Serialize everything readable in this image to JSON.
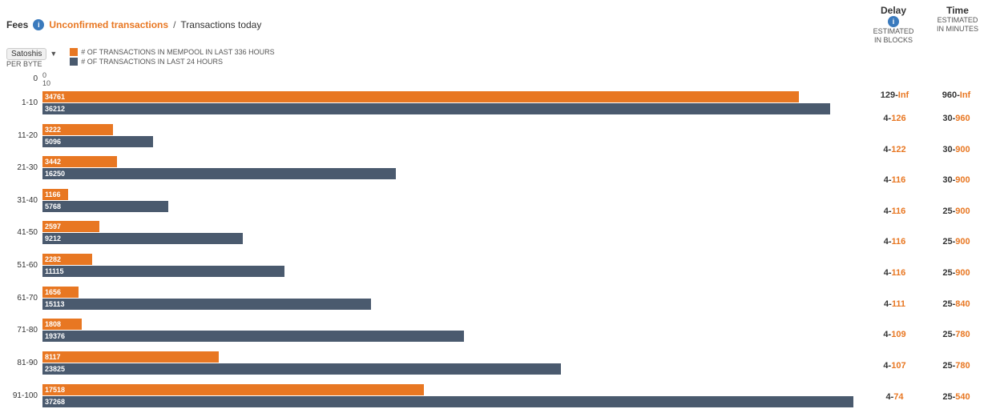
{
  "header": {
    "fees_label": "Fees",
    "unconfirmed_label": "Unconfirmed transactions",
    "separator": " / ",
    "today_label": "Transactions today",
    "satoshi_btn": "Satoshis",
    "per_byte": "PER BYTE",
    "legend_mempool": "# OF TRANSACTIONS IN MEMPOOL IN LAST 336 HOURS",
    "legend_24h": "# OF TRANSACTIONS IN LAST 24 HOURS"
  },
  "right_header": {
    "delay_label": "Delay",
    "delay_sub1": "ESTIMATED",
    "delay_sub2": "IN BLOCKS",
    "time_label": "Time",
    "time_sub1": "ESTIMATED",
    "time_sub2": "IN MINUTES"
  },
  "rows": [
    {
      "fee": "0",
      "sub": "10",
      "orange_val": 0,
      "slate_val": 0,
      "orange_label": "",
      "slate_label": "",
      "delay": "129-",
      "delay_inf": "Inf",
      "time": "960-",
      "time_inf": "Inf"
    },
    {
      "fee": "1-10",
      "orange_val": 34761,
      "slate_val": 36212,
      "orange_label": "34761",
      "slate_label": "36212",
      "delay": "4-",
      "delay_num": "126",
      "time": "30-",
      "time_num": "960"
    },
    {
      "fee": "11-20",
      "orange_val": 3222,
      "slate_val": 5096,
      "orange_label": "3222",
      "slate_label": "5096",
      "delay": "4-",
      "delay_num": "122",
      "time": "30-",
      "time_num": "900"
    },
    {
      "fee": "21-30",
      "orange_val": 3442,
      "slate_val": 16250,
      "orange_label": "3442",
      "slate_label": "16250",
      "delay": "4-",
      "delay_num": "116",
      "time": "30-",
      "time_num": "900"
    },
    {
      "fee": "31-40",
      "orange_val": 1166,
      "slate_val": 5768,
      "orange_label": "1166",
      "slate_label": "5768",
      "delay": "4-",
      "delay_num": "116",
      "time": "25-",
      "time_num": "900"
    },
    {
      "fee": "41-50",
      "orange_val": 2597,
      "slate_val": 9212,
      "orange_label": "2597",
      "slate_label": "9212",
      "delay": "4-",
      "delay_num": "116",
      "time": "25-",
      "time_num": "900"
    },
    {
      "fee": "51-60",
      "orange_val": 2282,
      "slate_val": 11115,
      "orange_label": "2282",
      "slate_label": "11115",
      "delay": "4-",
      "delay_num": "116",
      "time": "25-",
      "time_num": "900"
    },
    {
      "fee": "61-70",
      "orange_val": 1656,
      "slate_val": 15113,
      "orange_label": "1656",
      "slate_label": "15113",
      "delay": "4-",
      "delay_num": "111",
      "time": "25-",
      "time_num": "840"
    },
    {
      "fee": "71-80",
      "orange_val": 1808,
      "slate_val": 19376,
      "orange_label": "1808",
      "slate_label": "19376",
      "delay": "4-",
      "delay_num": "109",
      "time": "25-",
      "time_num": "780"
    },
    {
      "fee": "81-90",
      "orange_val": 8117,
      "slate_val": 23825,
      "orange_label": "8117",
      "slate_label": "23825",
      "delay": "4-",
      "delay_num": "107",
      "time": "25-",
      "time_num": "780"
    },
    {
      "fee": "91-100",
      "orange_val": 17518,
      "slate_val": 37268,
      "orange_label": "17518",
      "slate_label": "37268",
      "delay": "4-",
      "delay_num": "74",
      "time": "25-",
      "time_num": "540"
    }
  ],
  "max_val": 38000
}
